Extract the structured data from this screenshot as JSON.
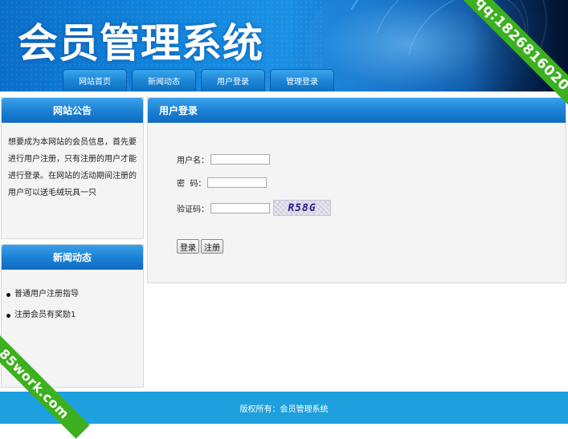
{
  "header": {
    "site_title": "会员管理系统",
    "nav": [
      {
        "label": "网站首页"
      },
      {
        "label": "新闻动态"
      },
      {
        "label": "用户登录"
      },
      {
        "label": "管理登录"
      }
    ]
  },
  "ribbons": {
    "top_right": "qq:1826816020",
    "bottom_left": "85work.com"
  },
  "notice_panel": {
    "title": "网站公告",
    "text": "想要成为本网站的会员信息，首先要进行用户注册，只有注册的用户才能进行登录。在网站的活动期间注册的用户可以送毛绒玩具一只"
  },
  "news_panel": {
    "title": "新闻动态",
    "items": [
      {
        "label": "普通用户注册指导"
      },
      {
        "label": "注册会员有奖励1"
      }
    ]
  },
  "login_panel": {
    "title": "用户登录",
    "username_label": "用户名：",
    "username_value": "",
    "password_label": "密  码：",
    "password_value": "",
    "captcha_label": "验证码：",
    "captcha_value": "",
    "captcha_image_text": "R58G",
    "login_button": "登录",
    "register_button": "注册"
  },
  "footer": {
    "text": "版权所有：会员管理系统"
  },
  "colors": {
    "header_blue": "#1286de",
    "panel_head_blue": "#1a7fd4",
    "footer_blue": "#1ea0de",
    "ribbon_green": "#3cb01e"
  }
}
